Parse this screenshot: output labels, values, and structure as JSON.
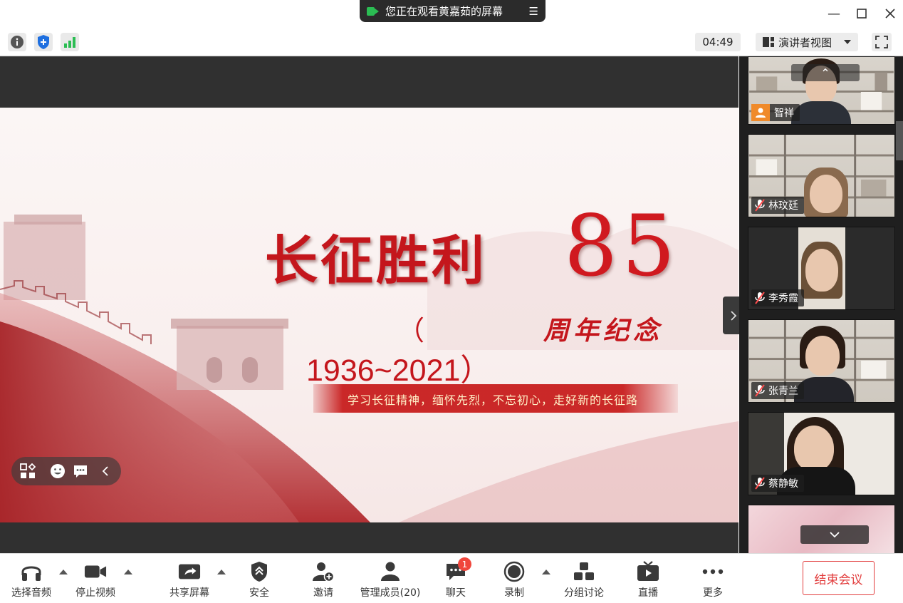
{
  "banner": {
    "text": "您正在观看黄嘉茹的屏幕",
    "icon": "screen-share-icon",
    "menu_icon": "menu-icon"
  },
  "window_controls": [
    "minimize-icon",
    "maximize-icon",
    "close-icon"
  ],
  "info_bar": {
    "icons": [
      "info-icon",
      "security-shield-icon",
      "network-signal-icon"
    ],
    "timer": "04:49",
    "view_mode": "演讲者视图",
    "fullscreen_icon": "fullscreen-icon"
  },
  "slide": {
    "title": "长征胜利",
    "number": "85",
    "paren_open": "（",
    "anniversary": "周年纪念",
    "years": "1936~2021）",
    "slogan": "学习长征精神，缅怀先烈，不忘初心，走好新的长征路"
  },
  "participants": [
    {
      "name": "智祥",
      "muted": false,
      "avatar_icon": true
    },
    {
      "name": "林玟廷",
      "muted": true
    },
    {
      "name": "李秀霞",
      "muted": true
    },
    {
      "name": "张青兰",
      "muted": true
    },
    {
      "name": "蔡静敏",
      "muted": true
    }
  ],
  "toolbar": {
    "audio": "选择音频",
    "video": "停止视频",
    "share": "共享屏幕",
    "security": "安全",
    "invite": "邀请",
    "members": "管理成员(20)",
    "chat": "聊天",
    "chat_badge": "1",
    "record": "录制",
    "breakout": "分组讨论",
    "live": "直播",
    "more": "更多",
    "end": "结束会议"
  },
  "colors": {
    "accent_red": "#e23d3d",
    "slide_red": "#c4161c",
    "badge": "#f0463c",
    "green": "#2bbd53"
  }
}
